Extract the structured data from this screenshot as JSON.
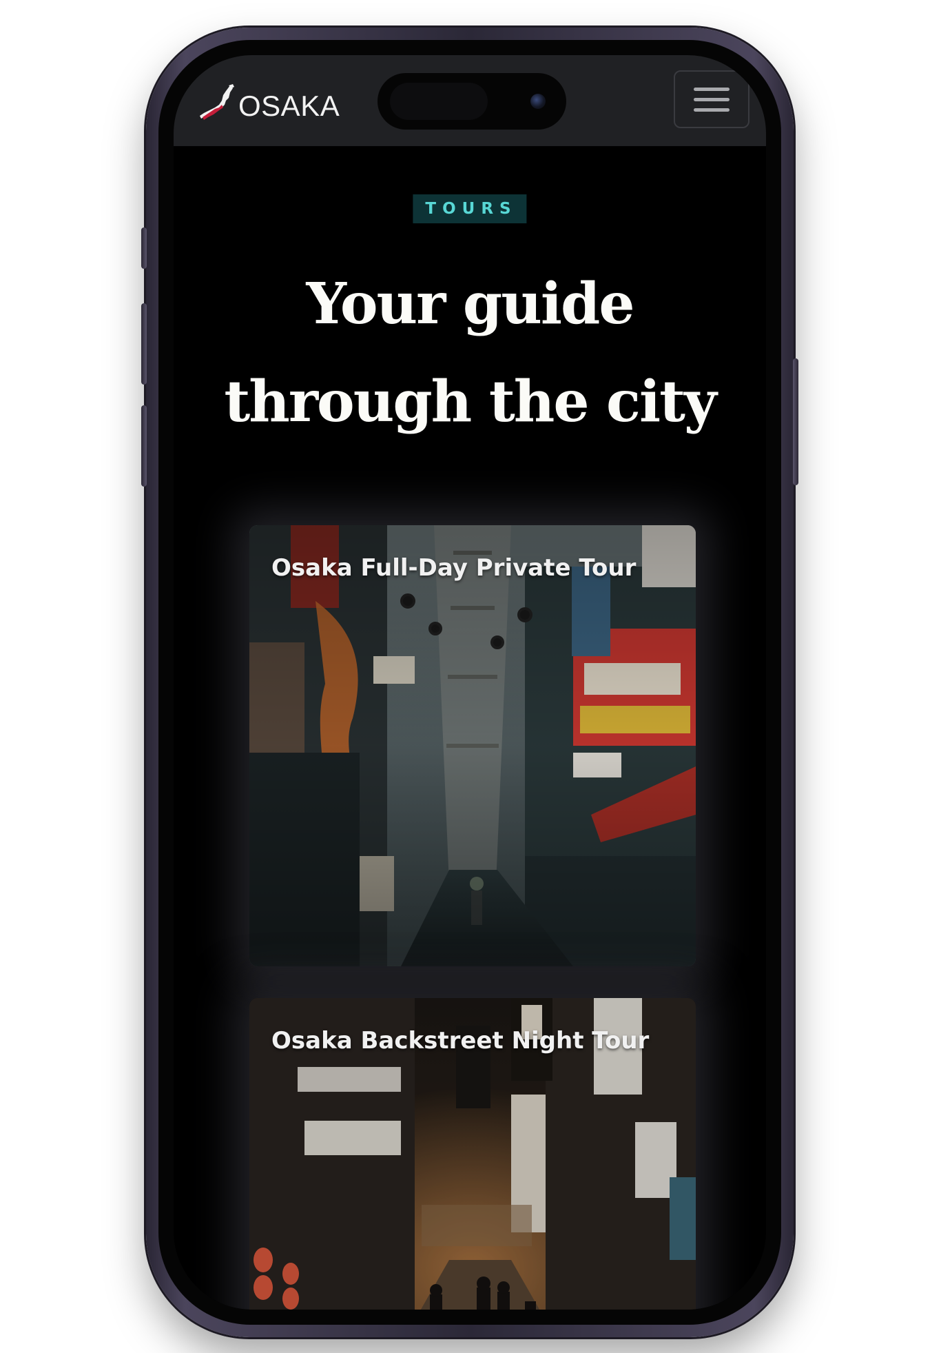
{
  "navbar": {
    "logo_text": "OSAKA",
    "logo_icon": "japan-map-icon",
    "menu_icon": "hamburger-menu-icon"
  },
  "hero": {
    "badge": "TOURS",
    "headline_line1": "Your guide",
    "headline_line2": "through the city"
  },
  "tours": [
    {
      "title": "Osaka Full-Day Private Tour"
    },
    {
      "title": "Osaka Backstreet Night Tour"
    }
  ],
  "colors": {
    "badge_bg": "#0d3336",
    "badge_text": "#58d7d5",
    "navbar_bg": "#202124",
    "page_bg": "#000000",
    "logo_accent": "#c41e3a"
  }
}
